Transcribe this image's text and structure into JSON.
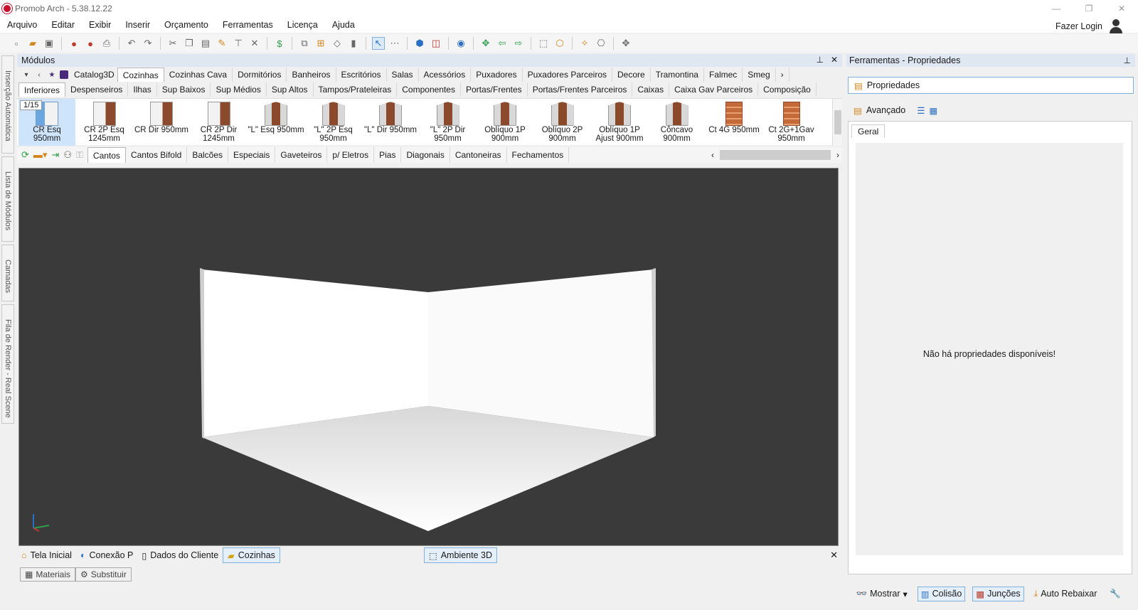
{
  "window": {
    "title": "Promob Arch - 5.38.12.22",
    "min": "—",
    "max": "❐",
    "close": "✕"
  },
  "menu": [
    "Arquivo",
    "Editar",
    "Exibir",
    "Inserir",
    "Orçamento",
    "Ferramentas",
    "Licença",
    "Ajuda"
  ],
  "account": {
    "login_label": "Fazer Login"
  },
  "left_tabs": [
    "Inserção Automática",
    "Lista de Módulos",
    "Camadas",
    "Fila de Render - Real Scene"
  ],
  "modules": {
    "title": "Módulos",
    "catalog": "Catalog3D",
    "categories": [
      "Cozinhas",
      "Cozinhas Cava",
      "Dormitórios",
      "Banheiros",
      "Escritórios",
      "Salas",
      "Acessórios",
      "Puxadores",
      "Puxadores Parceiros",
      "Decore",
      "Tramontina",
      "Falmec",
      "Smeg"
    ],
    "active_category": "Cozinhas",
    "subcategories": [
      "Inferiores",
      "Despenseiros",
      "Ilhas",
      "Sup Baixos",
      "Sup Médios",
      "Sup Altos",
      "Tampos/Prateleiras",
      "Componentes",
      "Portas/Frentes",
      "Portas/Frentes Parceiros",
      "Caixas",
      "Caixa Gav Parceiros",
      "Composição"
    ],
    "page_counter": "1/15",
    "items": [
      {
        "label": "CR Esq 950mm",
        "thumb": "blue"
      },
      {
        "label": "CR 2P Esq 1245mm",
        "thumb": "cab"
      },
      {
        "label": "CR Dir 950mm",
        "thumb": "cab"
      },
      {
        "label": "CR 2P Dir 1245mm",
        "thumb": "cab"
      },
      {
        "label": "\"L\" Esq 950mm",
        "thumb": "box3"
      },
      {
        "label": "\"L\" 2P Esq 950mm",
        "thumb": "box3"
      },
      {
        "label": "\"L\" Dir 950mm",
        "thumb": "box3"
      },
      {
        "label": "\"L\" 2P Dir 950mm",
        "thumb": "box3"
      },
      {
        "label": "Oblíquo 1P 900mm",
        "thumb": "box3"
      },
      {
        "label": "Oblíquo 2P 900mm",
        "thumb": "box3"
      },
      {
        "label": "Oblíquo 1P Ajust 900mm",
        "thumb": "box3"
      },
      {
        "label": "Côncavo 900mm",
        "thumb": "box3"
      },
      {
        "label": "Ct 4G 950mm",
        "thumb": "drw"
      },
      {
        "label": "Ct 2G+1Gav 950mm",
        "thumb": "drw"
      }
    ],
    "groups": [
      "Cantos",
      "Cantos Bifold",
      "Balcões",
      "Especiais",
      "Gaveteiros",
      "p/ Eletros",
      "Pias",
      "Diagonais",
      "Cantoneiras",
      "Fechamentos"
    ],
    "active_group": "Cantos"
  },
  "documents": {
    "tabs": [
      {
        "label": "Tela Inicial",
        "icon": "home-icon"
      },
      {
        "label": "Conexão P",
        "icon": "connection-icon"
      },
      {
        "label": "Dados do Cliente",
        "icon": "document-icon"
      },
      {
        "label": "Cozinhas",
        "icon": "folder-icon"
      }
    ],
    "view_tab": "Ambiente 3D",
    "close": "✕"
  },
  "bottom_tabs": [
    {
      "label": "Materiais"
    },
    {
      "label": "Substituir"
    }
  ],
  "right_panel": {
    "title": "Ferramentas - Propriedades",
    "properties_label": "Propriedades",
    "advanced_label": "Avançado",
    "tab_general": "Geral",
    "empty_message": "Não há propriedades disponíveis!"
  },
  "status": {
    "items": [
      {
        "label": "Mostrar",
        "on": false
      },
      {
        "label": "Colisão",
        "on": true
      },
      {
        "label": "Junções",
        "on": true
      },
      {
        "label": "Auto Rebaixar",
        "on": false
      }
    ]
  }
}
